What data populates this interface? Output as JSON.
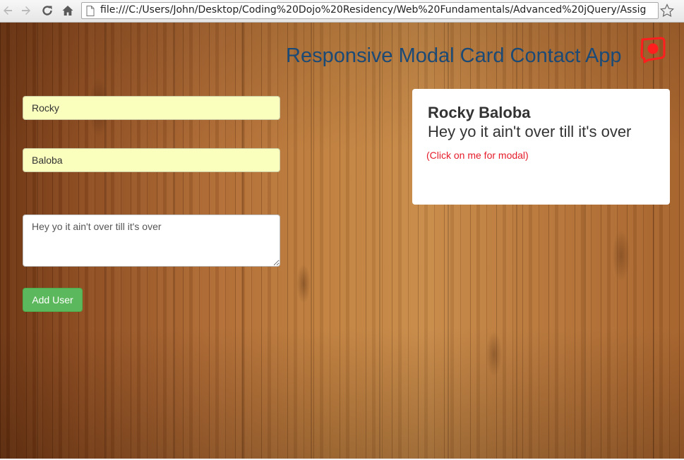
{
  "browser": {
    "url": "file:///C:/Users/John/Desktop/Coding%20Dojo%20Residency/Web%20Fundamentals/Advanced%20jQuery/Assig",
    "icons": [
      "back-arrow-icon",
      "forward-arrow-icon",
      "reload-icon",
      "home-icon",
      "page-icon",
      "star-icon"
    ]
  },
  "header": {
    "title": "Responsive Modal Card Contact App",
    "logo_icon": "red-circle-logo-icon",
    "title_color": "#1b4a77",
    "logo_color": "#ff1e1e"
  },
  "form": {
    "first_name_value": "Rocky",
    "last_name_value": "Baloba",
    "description_value": "Hey yo it ain't over till it's over",
    "add_button_label": "Add User",
    "autofill_color": "#faffbd",
    "button_color": "#5cb85c"
  },
  "card": {
    "name": "Rocky Baloba",
    "description": "Hey yo it ain't over till it's over",
    "hint": "(Click on me for modal)",
    "hint_color": "#e51b2a"
  }
}
